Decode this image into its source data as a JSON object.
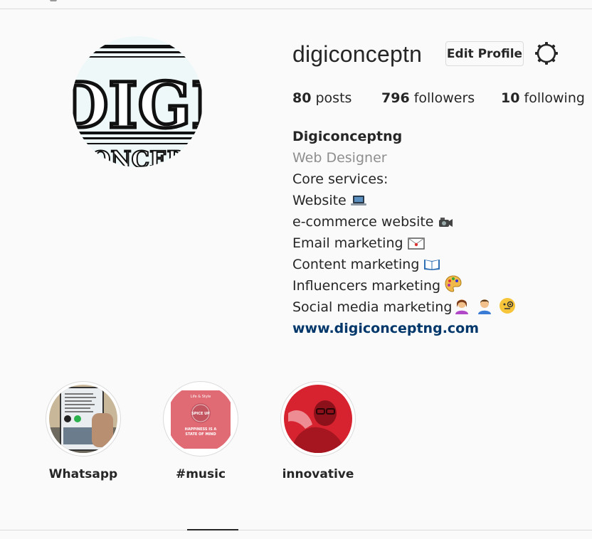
{
  "profile": {
    "username": "digiconceptn",
    "edit_label": "Edit Profile",
    "avatar_text_top": "DIGI",
    "avatar_text_bottom": "ONCEP"
  },
  "stats": {
    "posts_count": "80",
    "posts_label": "posts",
    "followers_count": "796",
    "followers_label": "followers",
    "following_count": "10",
    "following_label": "following"
  },
  "bio": {
    "name": "Digiconceptng",
    "category": "Web Designer",
    "lines": [
      "Core services:",
      "Website",
      "e-commerce website",
      "Email marketing",
      "Content marketing",
      "Influencers marketing",
      "Social media marketing"
    ],
    "link": "www.digiconceptng.com"
  },
  "highlights": [
    {
      "label": "Whatsapp"
    },
    {
      "label": "#music"
    },
    {
      "label": "innovative"
    }
  ],
  "highlight_thumb_text": {
    "music_top": "Life & Style",
    "music_badge": "SPICE UP",
    "music_line1": "HAPPINESS IS A",
    "music_line2": "STATE OF MIND"
  },
  "colors": {
    "link": "#00376b",
    "muted": "#8e8e8e",
    "border": "#dbdbdb",
    "innovative_bg": "#d7232f",
    "music_bg": "#e06b74"
  },
  "icons": [
    "settings-gear-icon",
    "laptop-emoji",
    "camera-emoji",
    "envelope-emoji",
    "open-book-emoji",
    "palette-emoji",
    "woman-emoji",
    "man-emoji",
    "monocle-face-emoji"
  ]
}
